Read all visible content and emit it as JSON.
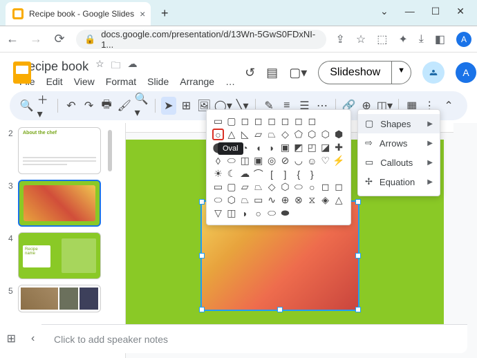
{
  "browser": {
    "tab_title": "Recipe book - Google Slides",
    "url": "docs.google.com/presentation/d/13Wn-5GwS0FDxNI-1...",
    "avatar_letter": "A"
  },
  "doc": {
    "title": "Recipe book",
    "menu": [
      "File",
      "Edit",
      "View",
      "Format",
      "Slide",
      "Arrange",
      "…"
    ],
    "slideshow_label": "Slideshow",
    "avatar_letter": "A"
  },
  "shape_categories": [
    {
      "icon": "square",
      "label": "Shapes",
      "active": true
    },
    {
      "icon": "arrow",
      "label": "Arrows",
      "active": false
    },
    {
      "icon": "callout",
      "label": "Callouts",
      "active": false
    },
    {
      "icon": "equation",
      "label": "Equation",
      "active": false
    }
  ],
  "shape_tooltip": "Oval",
  "thumbs": [
    {
      "n": "2",
      "type": "white"
    },
    {
      "n": "3",
      "type": "food",
      "selected": true
    },
    {
      "n": "4",
      "type": "green"
    },
    {
      "n": "5",
      "type": "collage"
    }
  ],
  "speaker_notes_placeholder": "Click to add speaker notes"
}
